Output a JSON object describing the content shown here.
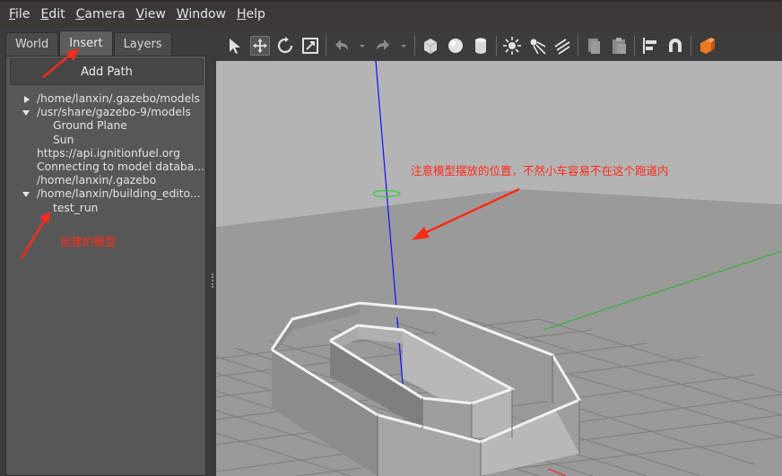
{
  "menu": {
    "items": [
      {
        "label": "File",
        "key": "F",
        "rest": "ile"
      },
      {
        "label": "Edit",
        "key": "E",
        "rest": "dit"
      },
      {
        "label": "Camera",
        "key": "C",
        "rest": "amera"
      },
      {
        "label": "View",
        "key": "V",
        "rest": "iew"
      },
      {
        "label": "Window",
        "key": "W",
        "rest": "indow"
      },
      {
        "label": "Help",
        "key": "H",
        "rest": "elp"
      }
    ]
  },
  "left_panel": {
    "tabs": [
      {
        "label": "World",
        "active": false
      },
      {
        "label": "Insert",
        "active": true
      },
      {
        "label": "Layers",
        "active": false
      }
    ],
    "add_path_label": "Add Path",
    "tree": [
      {
        "text": "/home/lanxin/.gazebo/models",
        "indent": 0,
        "arrow": "right"
      },
      {
        "text": "/usr/share/gazebo-9/models",
        "indent": 0,
        "arrow": "down"
      },
      {
        "text": "Ground Plane",
        "indent": 1,
        "arrow": "none"
      },
      {
        "text": "Sun",
        "indent": 1,
        "arrow": "none"
      },
      {
        "text": "https://api.ignitionfuel.org",
        "indent": 0,
        "arrow": "none"
      },
      {
        "text": "Connecting to model databa...",
        "indent": 0,
        "arrow": "none"
      },
      {
        "text": "/home/lanxin/.gazebo",
        "indent": 0,
        "arrow": "none"
      },
      {
        "text": "/home/lanxin/building_edito...",
        "indent": 0,
        "arrow": "down"
      },
      {
        "text": "test_run",
        "indent": 1,
        "arrow": "none"
      }
    ]
  },
  "toolbar": {
    "icons": [
      "select-arrow-icon",
      "translate-icon",
      "rotate-icon",
      "scale-icon",
      "undo-icon",
      "undo-dropdown-icon",
      "redo-icon",
      "redo-dropdown-icon",
      "box-shape-icon",
      "sphere-shape-icon",
      "cylinder-shape-icon",
      "point-light-icon",
      "spot-light-icon",
      "directional-light-icon",
      "copy-icon",
      "paste-icon",
      "align-icon",
      "snap-icon",
      "view-angle-icon"
    ]
  },
  "annotations": {
    "created_model": "创建的模型",
    "placement_note": "注意模型摆放的位置，不然小车容易不在这个跑道内"
  },
  "colors": {
    "annotation": "#ff2a1a",
    "sky": "#b4b4b4",
    "ground": "#9a9a9a",
    "z_axis": "#1010ff",
    "y_axis": "#28b428",
    "x_axis": "#ff2020",
    "accent_orange": "#f07820"
  }
}
